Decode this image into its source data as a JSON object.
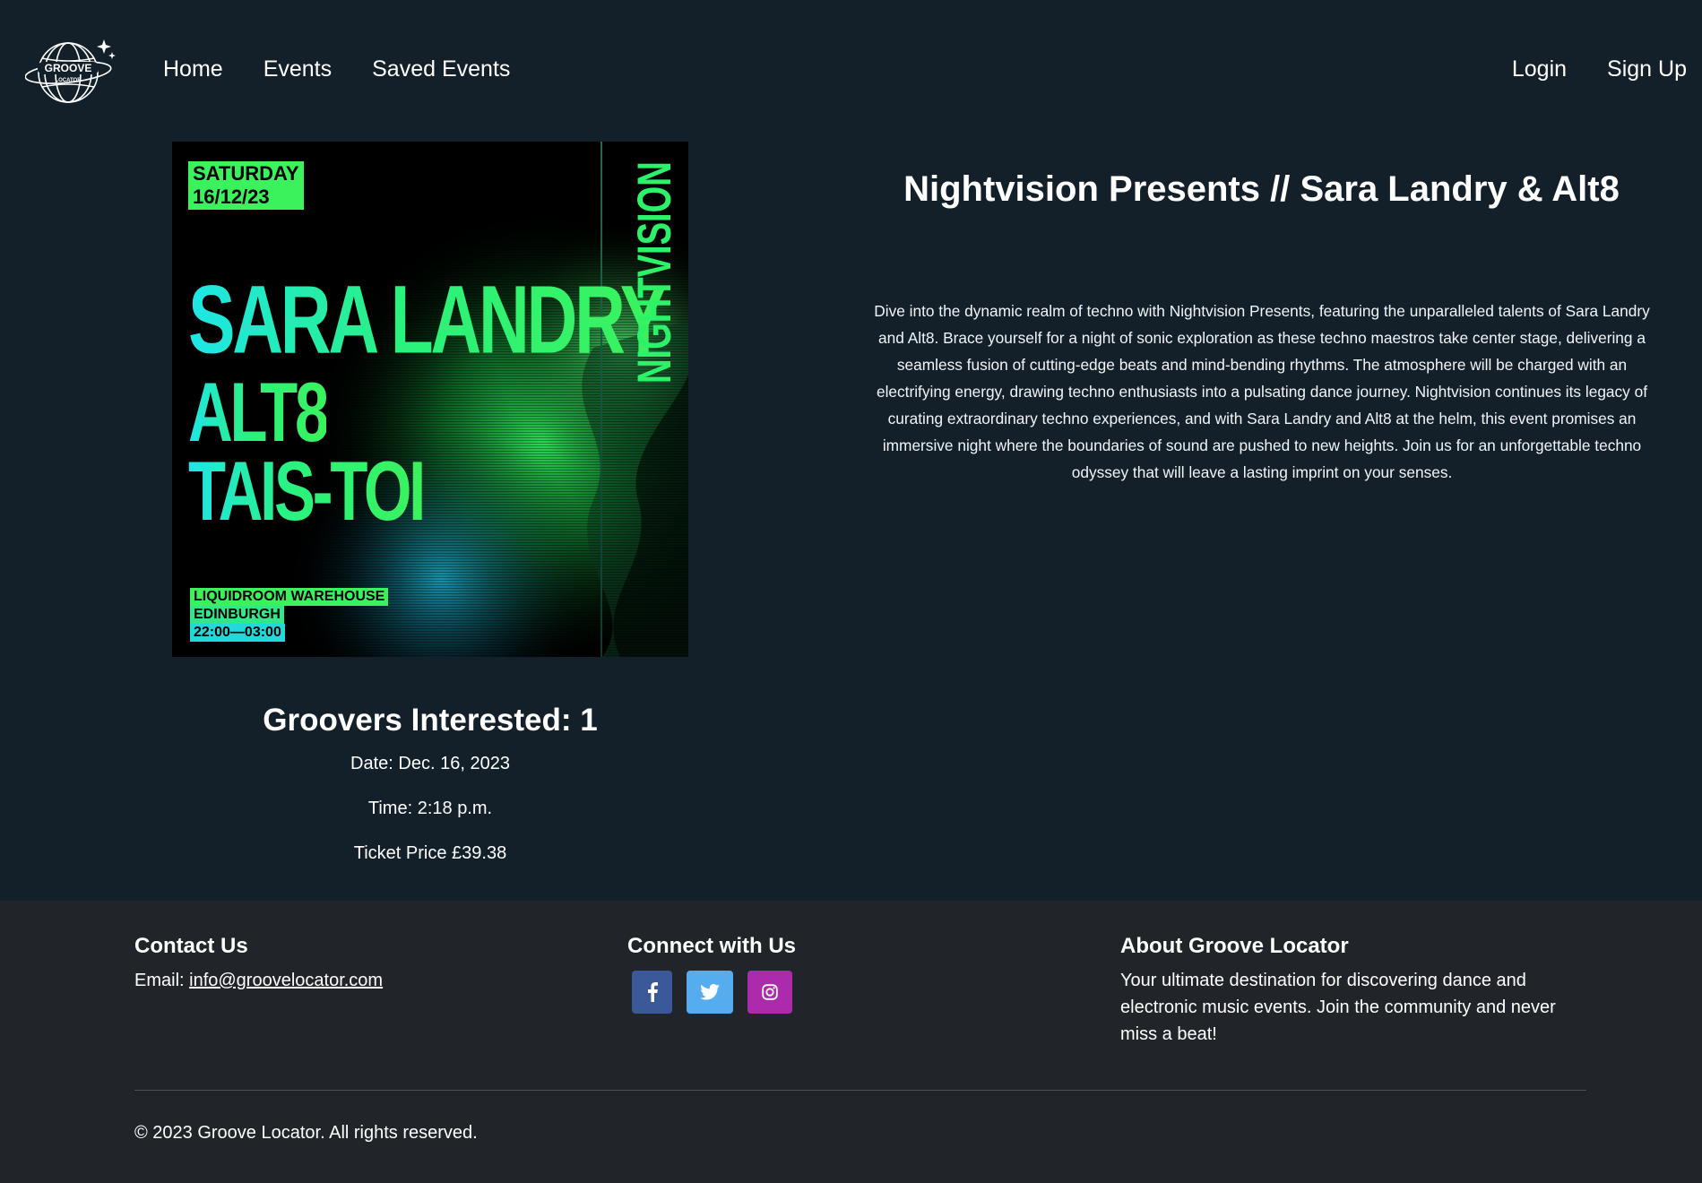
{
  "nav": {
    "logo_text": "GROOVE",
    "logo_sub": "LOCATOR",
    "home": "Home",
    "events": "Events",
    "saved_events": "Saved Events",
    "login": "Login",
    "signup": "Sign Up"
  },
  "poster": {
    "day": "SATURDAY",
    "date": "16/12/23",
    "artists": [
      "SARA LANDRY",
      "ALT8",
      "TAIS-TOI"
    ],
    "brand": "NIGHTVISION",
    "venue": "LIQUIDROOM  WAREHOUSE",
    "city": "EDINBURGH",
    "hours": "22:00—03:00"
  },
  "event": {
    "title": "Nightvision Presents // Sara Landry & Alt8",
    "description": "Dive into the dynamic realm of techno with Nightvision Presents, featuring the unparalleled talents of Sara Landry and Alt8. Brace yourself for a night of sonic exploration as these techno maestros take center stage, delivering a seamless fusion of cutting-edge beats and mind-bending rhythms. The atmosphere will be charged with an electrifying energy, drawing techno enthusiasts into a pulsating dance journey. Nightvision continues its legacy of curating extraordinary techno experiences, and with Sara Landry and Alt8 at the helm, this event promises an immersive night where the boundaries of sound are pushed to new heights. Join us for an unforgettable techno odyssey that will leave a lasting imprint on your senses.",
    "interested": "Groovers Interested: 1",
    "date": "Date: Dec. 16, 2023",
    "time": "Time: 2:18 p.m.",
    "price": "Ticket Price £39.38"
  },
  "footer": {
    "contact_heading": "Contact Us",
    "email_label": "Email: ",
    "email": "info@groovelocator.com",
    "connect_heading": "Connect with Us",
    "social": [
      {
        "icon": "facebook-icon",
        "color": "#3b5998"
      },
      {
        "icon": "twitter-icon",
        "color": "#55acee"
      },
      {
        "icon": "instagram-icon",
        "color": "#ac2bac"
      }
    ],
    "about_heading": "About Groove Locator",
    "about_text": "Your ultimate destination for discovering dance and electronic music events. Join the community and never miss a beat!",
    "copyright": "© 2023 Groove Locator. All rights reserved."
  },
  "colors": {
    "background": "#13202a",
    "footer": "#212429",
    "poster_accent": "#3bf25c"
  }
}
